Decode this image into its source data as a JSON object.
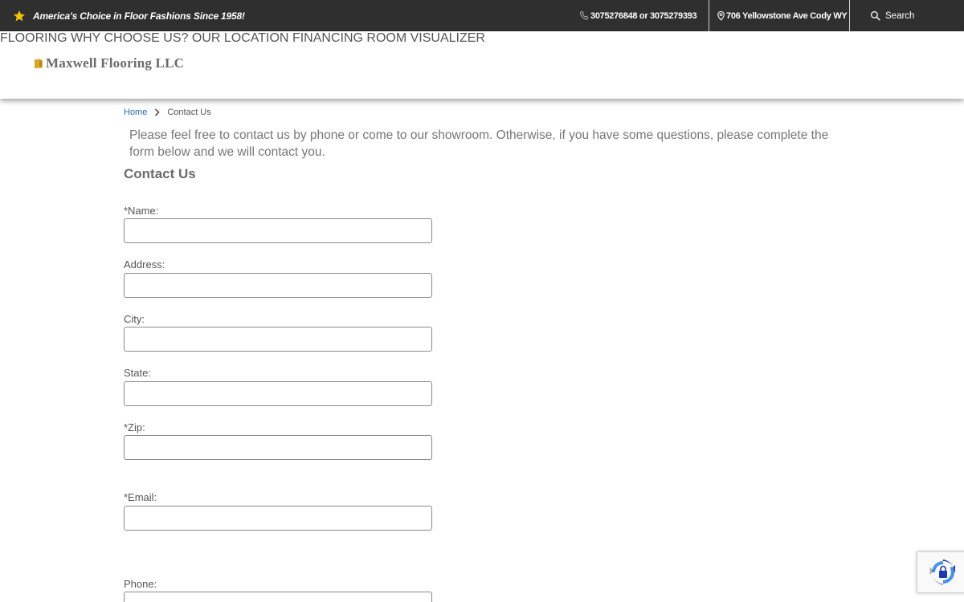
{
  "topbar": {
    "tagline": "America's Choice in Floor Fashions Since 1958!",
    "phone": "3075276848 or 3075279393",
    "address": "706 Yellowstone Ave Cody WY",
    "search_label": "Search"
  },
  "header": {
    "logo_text": "Maxwell Flooring LLC",
    "nav": [
      {
        "label": "FLOORING"
      },
      {
        "label": "WHY CHOOSE US?"
      },
      {
        "label": "OUR LOCATION"
      },
      {
        "label": "FINANCING"
      },
      {
        "label": "ROOM VISUALIZER"
      }
    ]
  },
  "breadcrumb": {
    "home": "Home",
    "current": "Contact Us"
  },
  "main": {
    "intro": "Please feel free to contact us by phone or come to our showroom. Otherwise, if you have some questions, please complete the form below and we will contact you.",
    "heading": "Contact Us",
    "form": {
      "fields": [
        {
          "label": "*Name:",
          "value": ""
        },
        {
          "label": "Address:",
          "value": ""
        },
        {
          "label": "City:",
          "value": ""
        },
        {
          "label": "State:",
          "value": ""
        },
        {
          "label": "*Zip:",
          "value": ""
        },
        {
          "label": "*Email:",
          "value": ""
        },
        {
          "label": "Phone:",
          "value": ""
        }
      ]
    }
  },
  "colors": {
    "topbar_bg": "#2f2f2f",
    "link": "#2b6aa6",
    "star": "#f4c20d"
  },
  "icons": {
    "tagline": "star-icon",
    "phone": "phone-icon",
    "address": "map-pin-icon",
    "search": "search-icon",
    "breadcrumb": "chevron-right-icon",
    "recaptcha": "recaptcha-icon"
  }
}
